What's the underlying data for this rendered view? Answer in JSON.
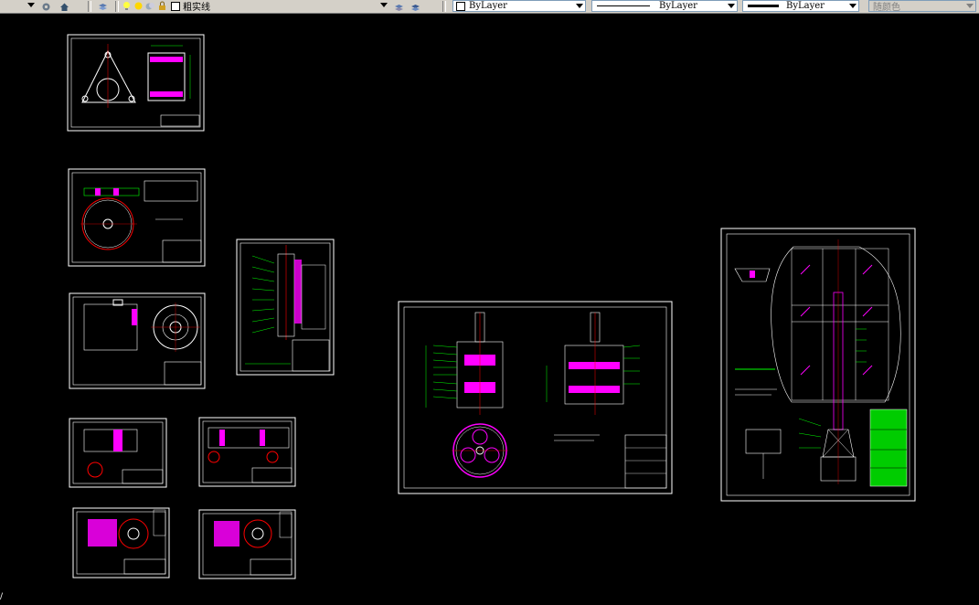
{
  "toolbar": {
    "layer_name": "粗实线",
    "color_control": "ByLayer",
    "linetype_control": "ByLayer",
    "lineweight_control": "ByLayer",
    "plotstyle_control": "随颜色"
  },
  "icons": {
    "workspace_settings": "gear-icon",
    "home": "home-icon",
    "layer_manager": "layers-icon",
    "layer_on": "lightbulb-icon",
    "layer_freeze": "sun-icon",
    "layer_lock": "lock-icon",
    "layer_color": "color-swatch-icon"
  },
  "colors": {
    "background": "#000000",
    "frame": "#ffffff",
    "dimension": "#00ff00",
    "hatch": "#ff00ff",
    "centerline": "#ff0000",
    "leader": "#ffff00"
  },
  "drawing_sheets": [
    {
      "id": "flange-plate"
    },
    {
      "id": "gear-ring"
    },
    {
      "id": "housing-section"
    },
    {
      "id": "shaft-assembly-section"
    },
    {
      "id": "small-shaft-a"
    },
    {
      "id": "small-shaft-b"
    },
    {
      "id": "bearing-seat-a"
    },
    {
      "id": "bearing-seat-b"
    },
    {
      "id": "planetary-gearbox-assembly"
    },
    {
      "id": "tower-crane-general-arrangement"
    }
  ]
}
